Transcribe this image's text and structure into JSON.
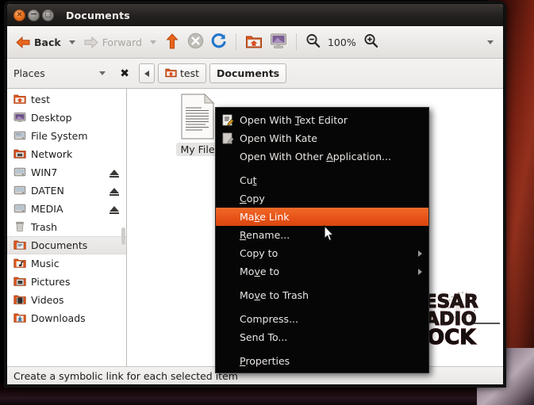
{
  "window": {
    "title": "Documents",
    "controls": [
      {
        "name": "close",
        "glyph": "×"
      },
      {
        "name": "minimize",
        "glyph": "−"
      },
      {
        "name": "maximize",
        "glyph": "□"
      }
    ]
  },
  "toolbar": {
    "back_label": "Back",
    "forward_label": "Forward",
    "up_icon": "up-arrow-icon",
    "stop_icon": "stop-icon",
    "reload_icon": "reload-icon",
    "home_icon": "home-folder-icon",
    "computer_icon": "computer-icon",
    "zoom_out_icon": "zoom-out-icon",
    "zoom_level": "100%",
    "zoom_in_icon": "zoom-in-icon",
    "overflow_icon": "toolbar-overflow-caret"
  },
  "pathbar": {
    "places_label": "Places",
    "places_caret": "chevron-down-icon",
    "close_sidebar_icon": "close-sidebar-x-icon",
    "crumbs": [
      {
        "label": "",
        "icon": "chevron-left-icon",
        "active": false
      },
      {
        "label": "test",
        "icon": "folder-home-icon",
        "active": false
      },
      {
        "label": "Documents",
        "icon": "",
        "active": true
      }
    ]
  },
  "sidebar": {
    "items": [
      {
        "label": "test",
        "icon": "folder-home-icon",
        "eject": false,
        "selected": false
      },
      {
        "label": "Desktop",
        "icon": "desktop-icon",
        "eject": false,
        "selected": false
      },
      {
        "label": "File System",
        "icon": "harddisk-icon",
        "eject": false,
        "selected": false
      },
      {
        "label": "Network",
        "icon": "network-icon",
        "eject": false,
        "selected": false
      },
      {
        "label": "WIN7",
        "icon": "harddisk-icon",
        "eject": true,
        "selected": false
      },
      {
        "label": "DATEN",
        "icon": "harddisk-icon",
        "eject": true,
        "selected": false
      },
      {
        "label": "MEDIA",
        "icon": "harddisk-icon",
        "eject": true,
        "selected": false
      },
      {
        "label": "Trash",
        "icon": "trash-icon",
        "eject": false,
        "selected": false
      },
      {
        "label": "Documents",
        "icon": "documents-icon",
        "eject": false,
        "selected": true
      },
      {
        "label": "Music",
        "icon": "music-icon",
        "eject": false,
        "selected": false
      },
      {
        "label": "Pictures",
        "icon": "pictures-icon",
        "eject": false,
        "selected": false
      },
      {
        "label": "Videos",
        "icon": "videos-icon",
        "eject": false,
        "selected": false
      },
      {
        "label": "Downloads",
        "icon": "downloads-icon",
        "eject": false,
        "selected": false
      }
    ]
  },
  "fileview": {
    "file_label": "My File",
    "file_icon": "text-document-icon",
    "watermark_lines": [
      "CESAR",
      "RADIO",
      "ROCK"
    ]
  },
  "context_menu": {
    "items": [
      {
        "label": "Open With Text Editor",
        "accel_index": 5,
        "icon": "text-editor-icon",
        "submenu": false,
        "highlight": false,
        "sep_after": false
      },
      {
        "label": "Open With Kate",
        "accel_index": -1,
        "icon": "kate-editor-icon",
        "submenu": false,
        "highlight": false,
        "sep_after": false
      },
      {
        "label": "Open With Other Application...",
        "accel_index": 16,
        "icon": "",
        "submenu": false,
        "highlight": false,
        "sep_after": true
      },
      {
        "label": "Cut",
        "accel_index": 2,
        "icon": "",
        "submenu": false,
        "highlight": false,
        "sep_after": false
      },
      {
        "label": "Copy",
        "accel_index": 0,
        "icon": "",
        "submenu": false,
        "highlight": false,
        "sep_after": false
      },
      {
        "label": "Make Link",
        "accel_index": 3,
        "icon": "",
        "submenu": false,
        "highlight": true,
        "sep_after": false
      },
      {
        "label": "Rename...",
        "accel_index": 0,
        "icon": "",
        "submenu": false,
        "highlight": false,
        "sep_after": false
      },
      {
        "label": "Copy to",
        "accel_index": -1,
        "icon": "",
        "submenu": true,
        "highlight": false,
        "sep_after": false
      },
      {
        "label": "Move to",
        "accel_index": 2,
        "icon": "",
        "submenu": true,
        "highlight": false,
        "sep_after": true
      },
      {
        "label": "Move to Trash",
        "accel_index": 2,
        "icon": "",
        "submenu": false,
        "highlight": false,
        "sep_after": true
      },
      {
        "label": "Compress...",
        "accel_index": -1,
        "icon": "",
        "submenu": false,
        "highlight": false,
        "sep_after": false
      },
      {
        "label": "Send To...",
        "accel_index": -1,
        "icon": "",
        "submenu": false,
        "highlight": false,
        "sep_after": true
      },
      {
        "label": "Properties",
        "accel_index": 0,
        "icon": "",
        "submenu": false,
        "highlight": false,
        "sep_after": false
      }
    ],
    "cursor": "mouse-pointer"
  },
  "statusbar": {
    "text": "Create a symbolic link for each selected item"
  },
  "colors": {
    "accent_orange": "#e8541a",
    "titlebar_dark": "#232020",
    "menu_bg": "#060606",
    "menu_text": "#e9e6e3",
    "window_chrome": "#f2f1f0"
  }
}
